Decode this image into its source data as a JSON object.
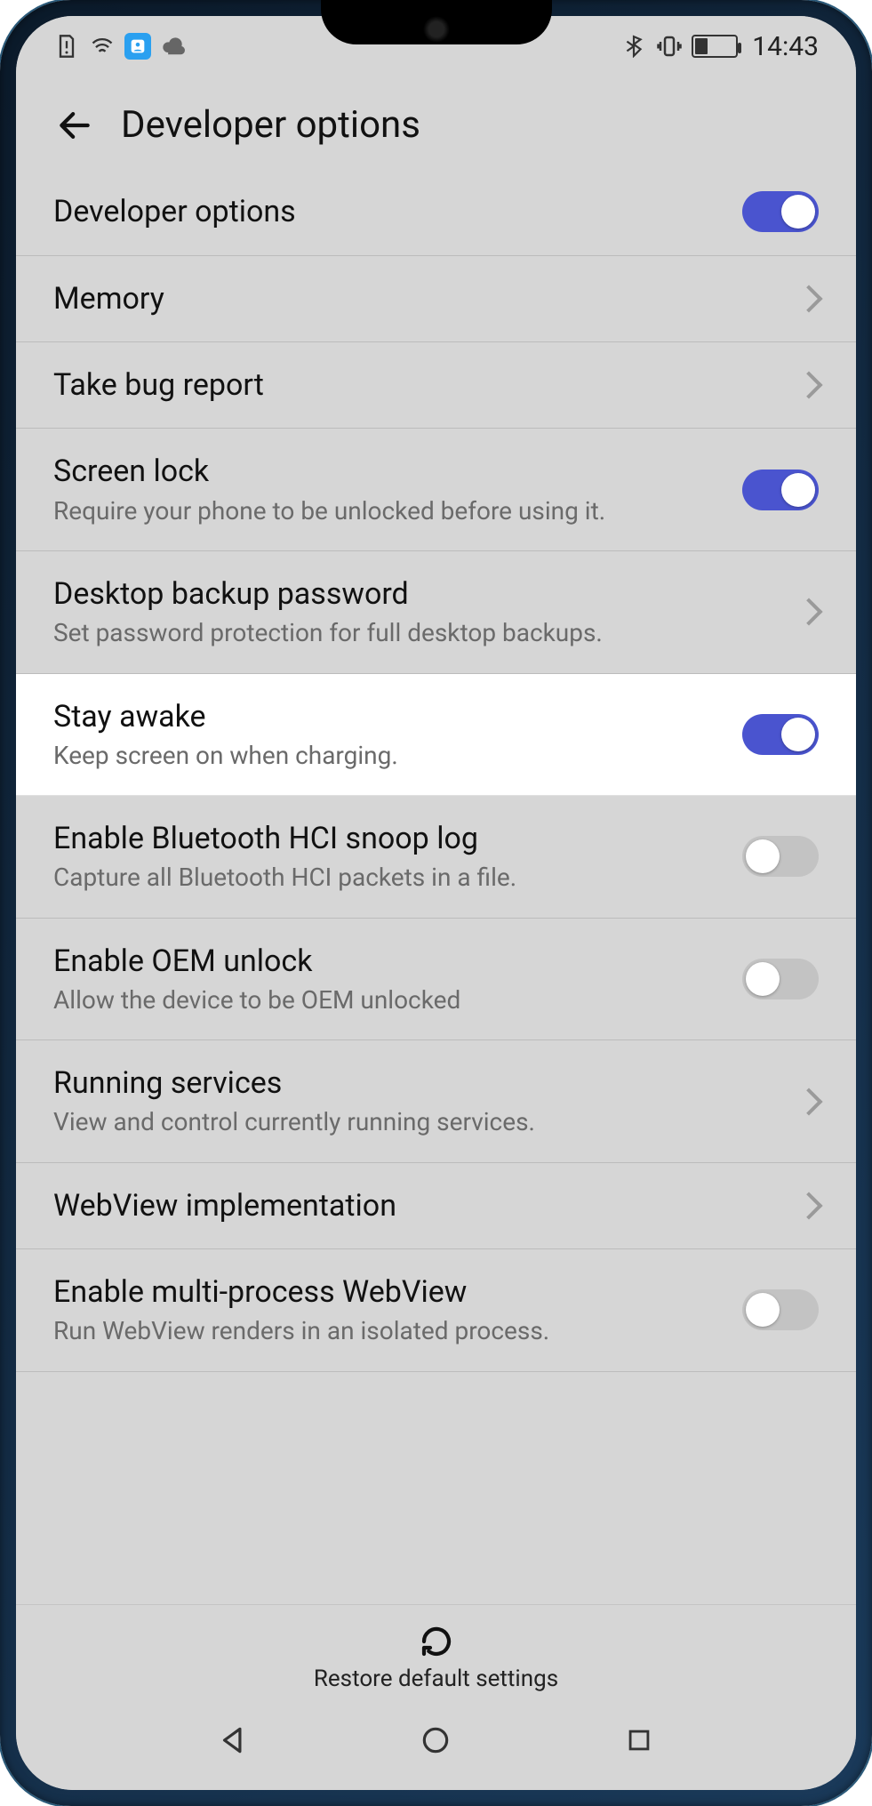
{
  "status": {
    "time": "14:43",
    "left_icons": [
      "sim-alert-icon",
      "wifi-signal-icon",
      "app-notification-icon",
      "cloud-icon"
    ],
    "right_icons": [
      "bluetooth-icon",
      "vibrate-icon",
      "battery-icon"
    ]
  },
  "header": {
    "title": "Developer options"
  },
  "rows": [
    {
      "id": "dev-options",
      "title": "Developer options",
      "sub": "",
      "action": "toggle",
      "state": "on",
      "highlight": false
    },
    {
      "id": "memory",
      "title": "Memory",
      "sub": "",
      "action": "chevron",
      "state": "",
      "highlight": false
    },
    {
      "id": "bug-report",
      "title": "Take bug report",
      "sub": "",
      "action": "chevron",
      "state": "",
      "highlight": false
    },
    {
      "id": "screen-lock",
      "title": "Screen lock",
      "sub": "Require your phone to be unlocked before using it.",
      "action": "toggle",
      "state": "on",
      "highlight": false
    },
    {
      "id": "desktop-backup",
      "title": "Desktop backup password",
      "sub": "Set password protection for full desktop backups.",
      "action": "chevron",
      "state": "",
      "highlight": false
    },
    {
      "id": "stay-awake",
      "title": "Stay awake",
      "sub": "Keep screen on when charging.",
      "action": "toggle",
      "state": "on",
      "highlight": true
    },
    {
      "id": "bt-hci",
      "title": "Enable Bluetooth HCI snoop log",
      "sub": "Capture all Bluetooth HCI packets in a file.",
      "action": "toggle",
      "state": "off",
      "highlight": false
    },
    {
      "id": "oem-unlock",
      "title": "Enable OEM unlock",
      "sub": "Allow the device to be OEM unlocked",
      "action": "toggle",
      "state": "off",
      "highlight": false
    },
    {
      "id": "running-services",
      "title": "Running services",
      "sub": "View and control currently running services.",
      "action": "chevron",
      "state": "",
      "highlight": false
    },
    {
      "id": "webview-impl",
      "title": "WebView implementation",
      "sub": "",
      "action": "chevron",
      "state": "",
      "highlight": false
    },
    {
      "id": "multi-webview",
      "title": "Enable multi-process WebView",
      "sub": "Run WebView renders in an isolated process.",
      "action": "toggle",
      "state": "off",
      "highlight": false
    }
  ],
  "restore": {
    "label": "Restore default settings"
  }
}
